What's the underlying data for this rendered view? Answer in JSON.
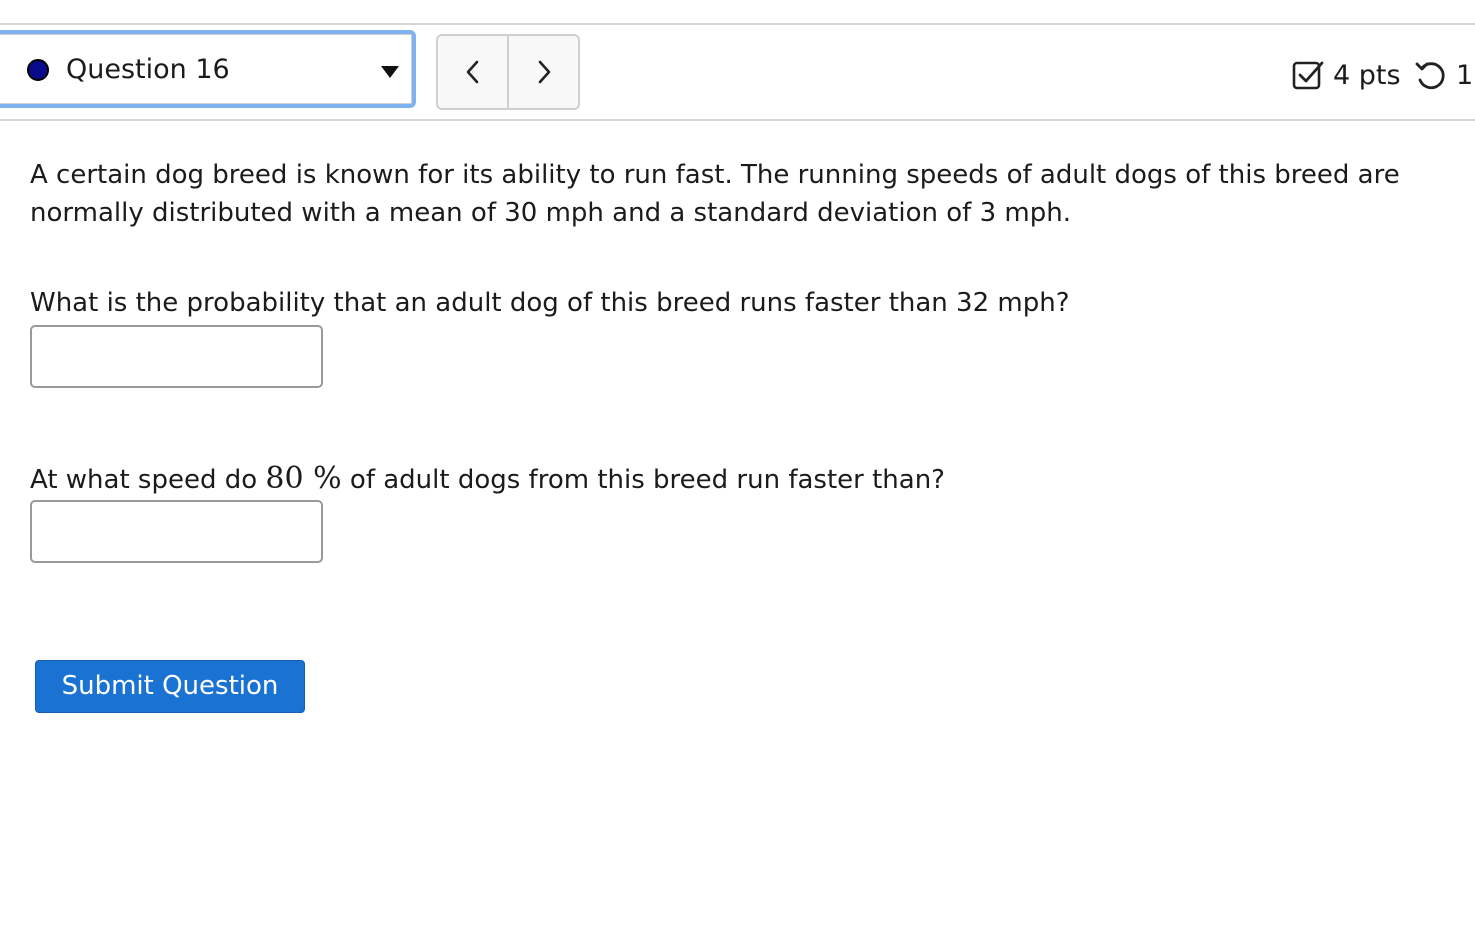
{
  "header": {
    "question_label": "Question 16",
    "status_color": "#0a0a8c",
    "points_text": "4 pts",
    "attempts_text": "1"
  },
  "nav": {
    "prev_icon": "chevron-left-icon",
    "next_icon": "chevron-right-icon"
  },
  "question": {
    "intro": "A certain dog breed is known for its ability to run fast. The running speeds of adult dogs of this breed are normally distributed with a mean of 30 mph and a standard deviation of 3 mph.",
    "part1_prompt": "What is the probability that an adult dog of this breed runs faster than 32 mph?",
    "part1_value": "",
    "part2_prompt_before": "At what speed do",
    "part2_math": "80 %",
    "part2_prompt_after": "of adult dogs from this breed run faster than?",
    "part2_value": ""
  },
  "actions": {
    "submit_label": "Submit Question",
    "accent_color": "#1a73d2"
  }
}
